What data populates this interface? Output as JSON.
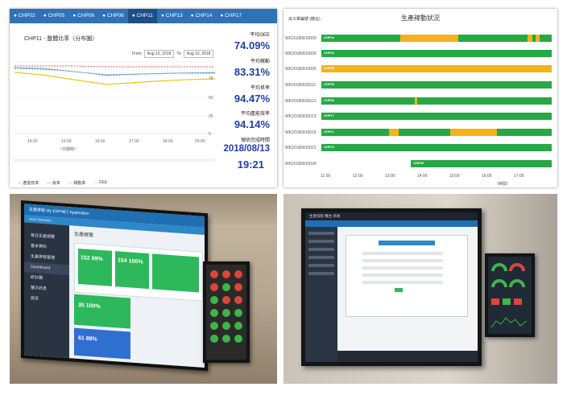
{
  "oee_panel": {
    "tabs": [
      "CHP02",
      "CHP05",
      "CHP06",
      "CHP08",
      "CHP11",
      "CHP13",
      "CHP14",
      "CHP17"
    ],
    "active_tab": "CHP11",
    "chart_title": "CHP11 - 整體比率（分布圖）",
    "range": {
      "from_label": "From",
      "from_value": "Aug 13, 2018",
      "to_label": "To",
      "to_value": "Aug 13, 2018"
    },
    "y_ticks": [
      "100",
      "75",
      "50",
      "25",
      "0"
    ],
    "x_ticks": [
      "14:00",
      "15:00",
      "16:00",
      "17:00",
      "18:00",
      "19:00"
    ],
    "x_label": "（日期時）",
    "legend": [
      "產能效率",
      "良率",
      "稼動率",
      "OEE"
    ],
    "kpis": [
      {
        "label": "平均OEE",
        "value": "74.09%"
      },
      {
        "label": "平均稼動",
        "value": "83.31%"
      },
      {
        "label": "平均良率",
        "value": "94.47%"
      },
      {
        "label": "平均產能效率",
        "value": "94.14%"
      },
      {
        "label": "預估完成時間",
        "value": "2018/08/13"
      },
      {
        "label": "",
        "value": "19:21"
      }
    ],
    "colors": {
      "tabbar": "#2f72b8",
      "kpi": "#1f3ea6",
      "oee": "#f0c419",
      "yield": "#e05555",
      "availability": "#2a7fb8"
    }
  },
  "gantt_panel": {
    "header_left": "派工單編號 (機台)",
    "title": "生產稼動狀況",
    "rows": [
      "WK20180810000",
      "WK20180810009",
      "WK20180810005",
      "WK20180810011",
      "WK20180810012",
      "WK20180810013",
      "WK20180810018",
      "WK20180810021",
      "WK20180810024"
    ],
    "bar_tags": [
      "CHP14",
      "CHP02",
      "CHP08",
      "CHP08",
      "CHP06",
      "CHP17",
      "CHP11",
      "CHP13",
      "CHP05"
    ],
    "x_ticks": [
      "11:00",
      "12:00",
      "13:00",
      "14:00",
      "15:00",
      "16:00",
      "17:00"
    ],
    "x_label": "（時間）",
    "colors": {
      "run": "#27a844",
      "idle": "#f5b21c"
    }
  },
  "photo_left": {
    "app_title": "生產排程  My ESPNET Application",
    "subtitle": "VGA Services",
    "sidebar": [
      "每日生產總覽",
      "基本資料",
      "生產排程管理",
      "Dashboard",
      "統計圖",
      "警示訊息",
      "設定"
    ],
    "main_title": "生產總覽",
    "cards": [
      {
        "a": "152",
        "b": "99%"
      },
      {
        "a": "154",
        "b": "100%"
      },
      {
        "a": "35",
        "b": "100%"
      },
      {
        "a": "61",
        "b": "88%"
      }
    ]
  },
  "photo_right": {
    "window_title": "生產排程  機台  系統"
  }
}
